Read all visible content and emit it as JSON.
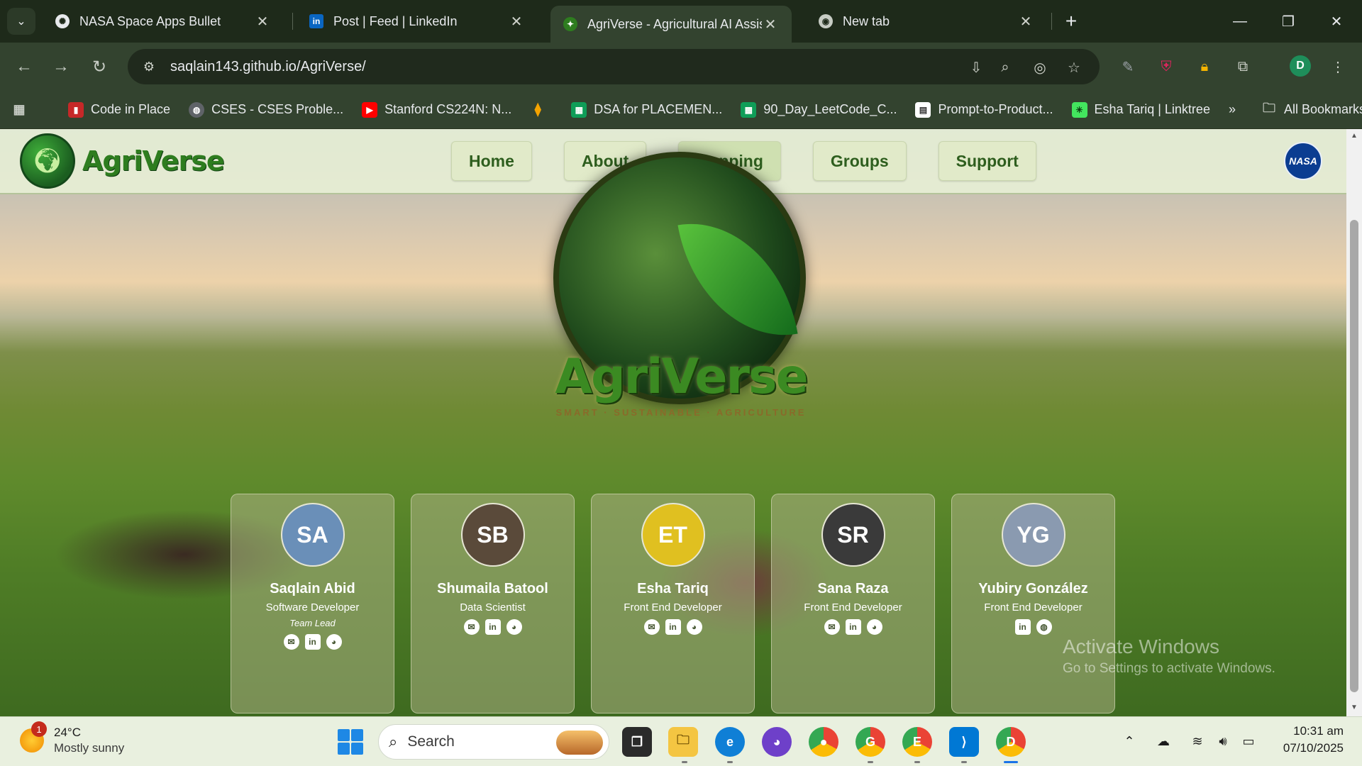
{
  "browser": {
    "tabs": [
      {
        "title": "NASA Space Apps Bullet",
        "icon": "openai-icon",
        "active": false
      },
      {
        "title": "Post | Feed | LinkedIn",
        "icon": "linkedin-icon",
        "active": false
      },
      {
        "title": "AgriVerse - Agricultural AI Assis",
        "icon": "agriverse-favicon",
        "active": true
      },
      {
        "title": "New tab",
        "icon": "chrome-icon",
        "active": false
      }
    ],
    "url": "saqlain143.github.io/AgriVerse/",
    "profile_initial": "D",
    "bookmarks": [
      {
        "label": "Code in Place",
        "color": "#c62828"
      },
      {
        "label": "CSES - CSES Proble...",
        "color": "#5f6368"
      },
      {
        "label": "Stanford CS224N: N...",
        "color": "#ff0000"
      },
      {
        "label": "",
        "color": "#f4a300"
      },
      {
        "label": "DSA for PLACEMEN...",
        "color": "#0f9d58"
      },
      {
        "label": "90_Day_LeetCode_C...",
        "color": "#0f9d58"
      },
      {
        "label": "Prompt-to-Product...",
        "color": "#ffffff"
      },
      {
        "label": "Esha Tariq | Linktree",
        "color": "#43e55e"
      }
    ],
    "all_bookmarks": "All Bookmarks"
  },
  "site": {
    "brand": "AgriVerse",
    "nav": [
      "Home",
      "About",
      "Mapping",
      "Groups",
      "Support"
    ],
    "nasa_logo": "NASA",
    "hero_title": "AgriVerse",
    "hero_tagline": "SMART · SUSTAINABLE · AGRICULTURE",
    "team": [
      {
        "name": "Saqlain Abid",
        "role": "Software Developer",
        "note": "Team Lead",
        "initials": "SA",
        "avatar_color": "#6a8fb8",
        "socials": [
          "email",
          "linkedin",
          "github"
        ]
      },
      {
        "name": "Shumaila Batool",
        "role": "Data Scientist",
        "note": "",
        "initials": "SB",
        "avatar_color": "#5a4a3a",
        "socials": [
          "email",
          "linkedin",
          "github"
        ]
      },
      {
        "name": "Esha Tariq",
        "role": "Front End Developer",
        "note": "",
        "initials": "ET",
        "avatar_color": "#e0c020",
        "socials": [
          "email",
          "linkedin",
          "github"
        ]
      },
      {
        "name": "Sana Raza",
        "role": "Front End Developer",
        "note": "",
        "initials": "SR",
        "avatar_color": "#3a3a3a",
        "socials": [
          "email",
          "linkedin",
          "github"
        ]
      },
      {
        "name": "Yubiry González",
        "role": "Front End Developer",
        "note": "",
        "initials": "YG",
        "avatar_color": "#8a9ab0",
        "socials": [
          "linkedin",
          "website"
        ]
      }
    ]
  },
  "watermark": {
    "line1": "Activate Windows",
    "line2": "Go to Settings to activate Windows."
  },
  "taskbar": {
    "weather_temp": "24°C",
    "weather_desc": "Mostly sunny",
    "weather_badge": "1",
    "search_placeholder": "Search",
    "time": "10:31 am",
    "date": "07/10/2025",
    "apps": [
      "task-view",
      "file-explorer",
      "edge",
      "github-desktop",
      "chrome",
      "chrome-profile-g",
      "chrome-profile-e",
      "vscode",
      "chrome-profile-d"
    ]
  }
}
